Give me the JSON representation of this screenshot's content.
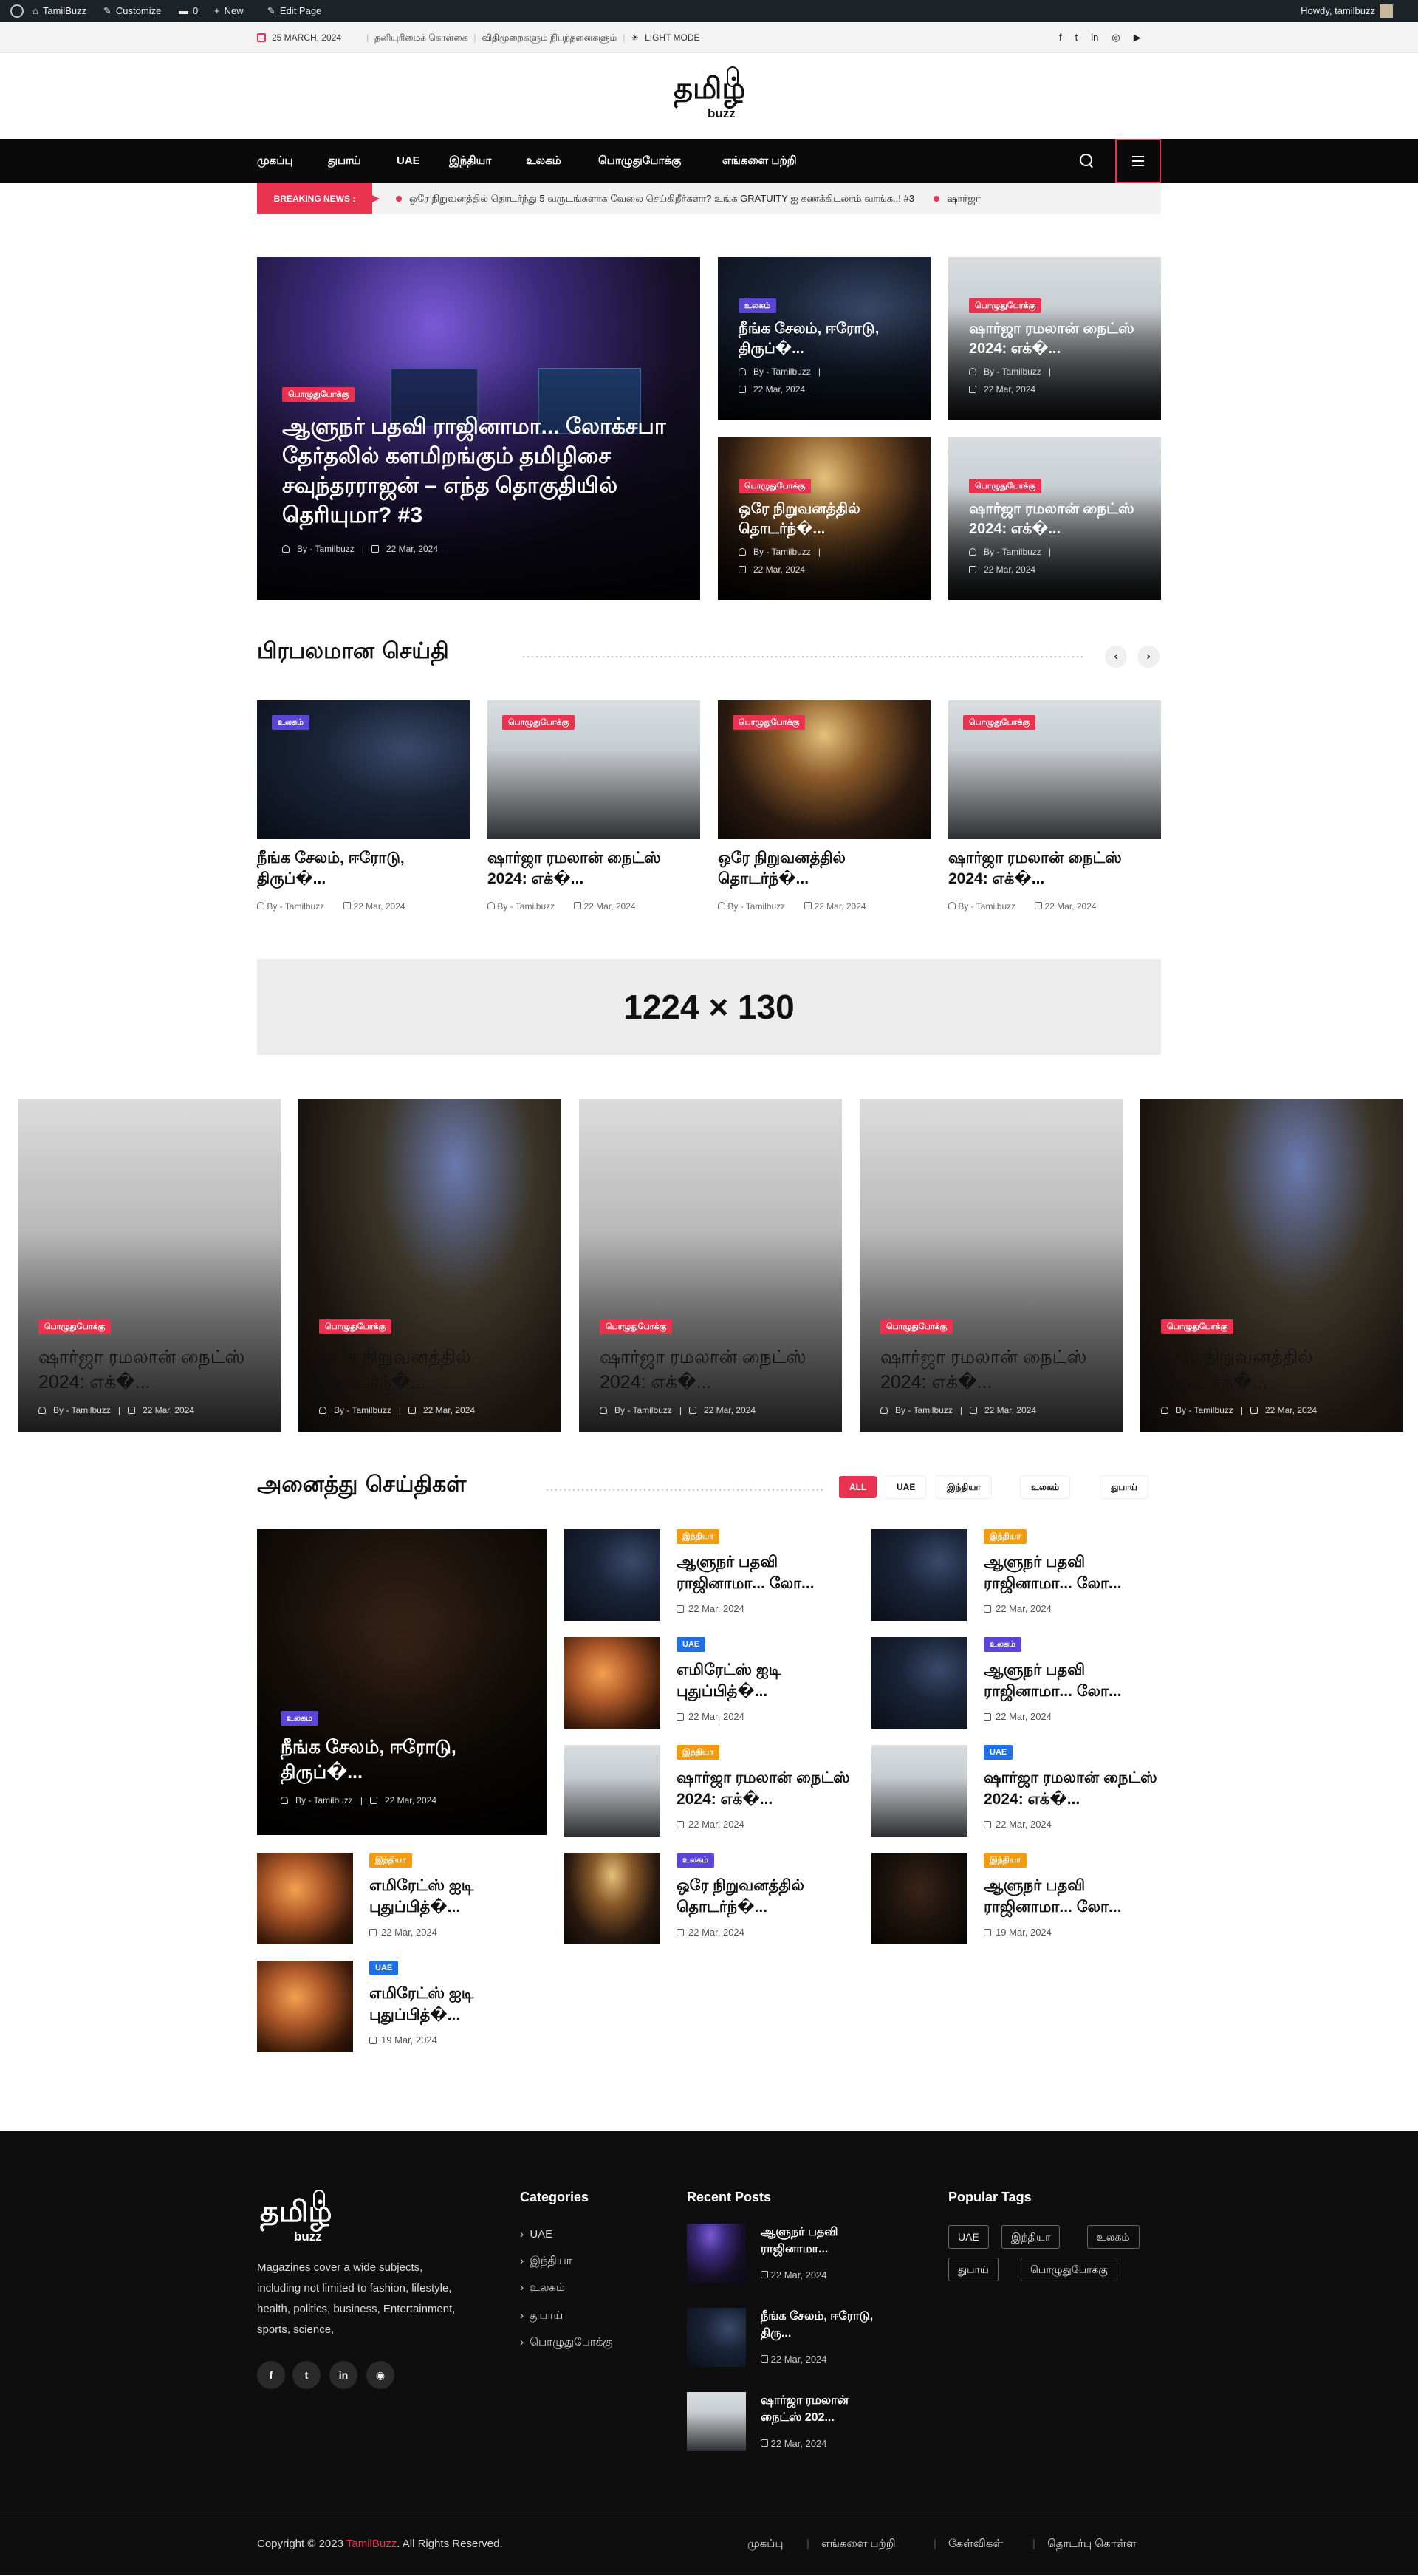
{
  "admin_bar": {
    "site": "TamilBuzz",
    "customize": "Customize",
    "comments": "0",
    "new": "New",
    "edit": "Edit Page",
    "howdy": "Howdy, tamilbuzz"
  },
  "topbar": {
    "date": "25 MARCH, 2024",
    "links": [
      "தனியுரிமைக் கொள்கை",
      "விதிமுறைகளும் நிபந்தனைகளும்"
    ],
    "mode": "LIGHT MODE",
    "social_icons": [
      "facebook-icon",
      "twitter-icon",
      "linkedin-icon",
      "instagram-icon",
      "youtube-icon"
    ]
  },
  "logo": {
    "tamil": "தமிழ்",
    "buzz": "buzz"
  },
  "nav": {
    "items": [
      "முகப்பு",
      "துபாய்",
      "UAE",
      "இந்தியா",
      "உலகம்",
      "பொழுதுபோக்கு",
      "எங்களை பற்றி"
    ]
  },
  "breaking": {
    "label": "BREAKING NEWS :",
    "items": [
      "ஒரே நிறுவனத்தில் தொடர்ந்து 5 வருடங்களாக வேலை செய்கிறீர்களா? உங்க GRATUITY ஐ கணக்கிடலாம் வாங்க..! #3",
      "ஷார்ஜா"
    ]
  },
  "hero": {
    "main": {
      "badge": "பொழுதுபோக்கு",
      "title": "ஆளுநர் பதவி ராஜினாமா... லோக்சபா தேர்தலில் களமிறங்கும் தமிழிசை சவுந்தரராஜன் – எந்த தொகுதியில் தெரியுமா? #3",
      "author": "By - Tamilbuzz",
      "date": "22 Mar, 2024"
    },
    "small": [
      {
        "badge": "உலகம்",
        "title": "நீங்க சேலம், ஈரோடு, திருப்�...",
        "author": "By - Tamilbuzz",
        "date": "22 Mar, 2024"
      },
      {
        "badge": "பொழுதுபோக்கு",
        "title": "ஷார்ஜா ரமலான் நைட்ஸ் 2024: எக்�...",
        "author": "By - Tamilbuzz",
        "date": "22 Mar, 2024"
      },
      {
        "badge": "பொழுதுபோக்கு",
        "title": "ஒரே நிறுவனத்தில் தொடர்ந்�...",
        "author": "By - Tamilbuzz",
        "date": "22 Mar, 2024"
      },
      {
        "badge": "பொழுதுபோக்கு",
        "title": "ஷார்ஜா ரமலான் நைட்ஸ் 2024: எக்�...",
        "author": "By - Tamilbuzz",
        "date": "22 Mar, 2024"
      }
    ]
  },
  "popular": {
    "heading": "பிரபலமான செய்தி",
    "items": [
      {
        "badge": "உலகம்",
        "title": "நீங்க சேலம், ஈரோடு, திருப்�...",
        "author": "By - Tamilbuzz",
        "date": "22 Mar, 2024"
      },
      {
        "badge": "பொழுதுபோக்கு",
        "title": "ஷார்ஜா ரமலான் நைட்ஸ் 2024: எக்�...",
        "author": "By - Tamilbuzz",
        "date": "22 Mar, 2024"
      },
      {
        "badge": "பொழுதுபோக்கு",
        "title": "ஒரே நிறுவனத்தில் தொடர்ந்�...",
        "author": "By - Tamilbuzz",
        "date": "22 Mar, 2024"
      },
      {
        "badge": "பொழுதுபோக்கு",
        "title": "ஷார்ஜா ரமலான் நைட்ஸ் 2024: எக்�...",
        "author": "By - Tamilbuzz",
        "date": "22 Mar, 2024"
      }
    ]
  },
  "ad": {
    "text": "1224 × 130"
  },
  "carousel": [
    {
      "badge": "பொழுதுபோக்கு",
      "title": "ஷார்ஜா ரமலான் நைட்ஸ் 2024: எக்�...",
      "author": "By - Tamilbuzz",
      "date": "22 Mar, 2024"
    },
    {
      "badge": "பொழுதுபோக்கு",
      "title": "ஒரே நிறுவனத்தில் தொடர்ந்�...",
      "author": "By - Tamilbuzz",
      "date": "22 Mar, 2024"
    },
    {
      "badge": "பொழுதுபோக்கு",
      "title": "ஷார்ஜா ரமலான் நைட்ஸ் 2024: எக்�...",
      "author": "By - Tamilbuzz",
      "date": "22 Mar, 2024"
    },
    {
      "badge": "பொழுதுபோக்கு",
      "title": "ஷார்ஜா ரமலான் நைட்ஸ் 2024: எக்�...",
      "author": "By - Tamilbuzz",
      "date": "22 Mar, 2024"
    },
    {
      "badge": "பொழுதுபோக்கு",
      "title": "ஒரே நிறுவனத்தில் தொடர்ந்�...",
      "author": "By - Tamilbuzz",
      "date": "22 Mar, 2024"
    }
  ],
  "all_news": {
    "heading": "அனைத்து செய்திகள்",
    "filters": [
      "ALL",
      "UAE",
      "இந்தியா",
      "உலகம்",
      "துபாய்"
    ],
    "feature": {
      "badge": "உலகம்",
      "title": "நீங்க சேலம், ஈரோடு, திருப்�...",
      "author": "By - Tamilbuzz",
      "date": "22 Mar, 2024"
    },
    "list": [
      {
        "badge": "இந்தியா",
        "title": "ஆளுநர் பதவி ராஜினாமா... லோ...",
        "date": "22 Mar, 2024"
      },
      {
        "badge": "இந்தியா",
        "title": "ஆளுநர் பதவி ராஜினாமா... லோ...",
        "date": "22 Mar, 2024"
      },
      {
        "badge": "UAE",
        "title": "எமிரேட்ஸ் ஐடி புதுப்பித்�...",
        "date": "22 Mar, 2024"
      },
      {
        "badge": "உலகம்",
        "title": "ஆளுநர் பதவி ராஜினாமா... லோ...",
        "date": "22 Mar, 2024"
      },
      {
        "badge": "இந்தியா",
        "title": "ஷார்ஜா ரமலான் நைட்ஸ் 2024: எக்�...",
        "date": "22 Mar, 2024"
      },
      {
        "badge": "UAE",
        "title": "ஷார்ஜா ரமலான் நைட்ஸ் 2024: எக்�...",
        "date": "22 Mar, 2024"
      },
      {
        "badge": "இந்தியா",
        "title": "எமிரேட்ஸ் ஐடி புதுப்பித்�...",
        "date": "22 Mar, 2024"
      },
      {
        "badge": "உலகம்",
        "title": "ஒரே நிறுவனத்தில் தொடர்ந்�...",
        "date": "22 Mar, 2024"
      },
      {
        "badge": "இந்தியா",
        "title": "ஆளுநர் பதவி ராஜினாமா... லோ...",
        "date": "19 Mar, 2024"
      },
      {
        "badge": "UAE",
        "title": "எமிரேட்ஸ் ஐடி புதுப்பித்�...",
        "date": "19 Mar, 2024"
      }
    ]
  },
  "footer": {
    "about": "Magazines cover a wide subjects, including not limited to fashion, lifestyle, health, politics, business, Entertainment, sports, science,",
    "categories_heading": "Categories",
    "categories": [
      "UAE",
      "இந்தியா",
      "உலகம்",
      "துபாய்",
      "பொழுதுபோக்கு"
    ],
    "recent_heading": "Recent Posts",
    "recent": [
      {
        "title": "ஆளுநர் பதவி ராஜினாமா...",
        "date": "22 Mar, 2024"
      },
      {
        "title": "நீங்க சேலம், ஈரோடு, திரு...",
        "date": "22 Mar, 2024"
      },
      {
        "title": "ஷார்ஜா ரமலான் நைட்ஸ் 202...",
        "date": "22 Mar, 2024"
      }
    ],
    "tags_heading": "Popular Tags",
    "tags": [
      "UAE",
      "இந்தியா",
      "உலகம்",
      "துபாய்",
      "பொழுதுபோக்கு"
    ],
    "copyright_pre": "Copyright © 2023 ",
    "brand": "TamilBuzz",
    "copyright_post": ". All Rights Reserved.",
    "bottom_links": [
      "முகப்பு",
      "எங்களை பற்றி",
      "கேள்விகள்",
      "தொடர்பு கொள்ள"
    ]
  },
  "colors": {
    "accent": "#e8324f",
    "dark": "#0a0a0a",
    "purple": "#5b45d6",
    "orange": "#f39c12",
    "blue": "#1f6fe5"
  }
}
